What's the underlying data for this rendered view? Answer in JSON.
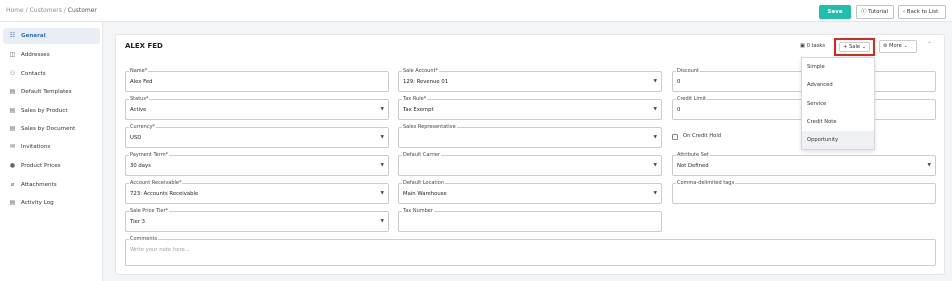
{
  "breadcrumb": {
    "home": "Home",
    "sep": "/",
    "customers": "Customers",
    "current": "Customer"
  },
  "toolbar": {
    "save": "Save",
    "tutorial": "Tutorial",
    "back": "Back to List"
  },
  "sidebar": {
    "items": [
      {
        "label": "General",
        "icon": "general-icon",
        "glyph": "☷",
        "active": true
      },
      {
        "label": "Addresses",
        "icon": "map-icon",
        "glyph": "◫",
        "active": false
      },
      {
        "label": "Contacts",
        "icon": "contacts-icon",
        "glyph": "⚇",
        "active": false
      },
      {
        "label": "Default Templates",
        "icon": "document-icon",
        "glyph": "▤",
        "active": false
      },
      {
        "label": "Sales by Product",
        "icon": "document-icon",
        "glyph": "▤",
        "active": false
      },
      {
        "label": "Sales by Document",
        "icon": "document-icon",
        "glyph": "▤",
        "active": false
      },
      {
        "label": "Invitations",
        "icon": "mail-icon",
        "glyph": "✉",
        "active": false
      },
      {
        "label": "Product Prices",
        "icon": "price-icon",
        "glyph": "●",
        "active": false
      },
      {
        "label": "Attachments",
        "icon": "paperclip-icon",
        "glyph": "⌀",
        "active": false
      },
      {
        "label": "Activity Log",
        "icon": "log-icon",
        "glyph": "▤",
        "active": false
      }
    ]
  },
  "header": {
    "title": "ALEX FED",
    "tasks": "0 tasks",
    "sale": "Sale",
    "more": "More"
  },
  "form": {
    "name": {
      "label": "Name*",
      "value": "Alex Fed"
    },
    "status": {
      "label": "Status*",
      "value": "Active"
    },
    "currency": {
      "label": "Currency*",
      "value": "USD"
    },
    "payment_term": {
      "label": "Payment Term*",
      "value": "30 days"
    },
    "account_receivable": {
      "label": "Account Receivable*",
      "value": "723: Accounts Receivable"
    },
    "sale_price_tier": {
      "label": "Sale Price Tier*",
      "value": "Tier 3"
    },
    "sale_account": {
      "label": "Sale Account*",
      "value": "129: Revenue 01"
    },
    "tax_rule": {
      "label": "Tax Rule*",
      "value": "Tax Exempt"
    },
    "sales_representative": {
      "label": "Sales Representative",
      "value": ""
    },
    "default_carrier": {
      "label": "Default Carrier",
      "value": ""
    },
    "default_location": {
      "label": "Default Location",
      "value": "Main Warehouse"
    },
    "tax_number": {
      "label": "Tax Number",
      "value": ""
    },
    "discount": {
      "label": "Discount",
      "value": "0"
    },
    "credit_limit": {
      "label": "Credit Limit",
      "value": "0"
    },
    "on_credit_hold": {
      "label": "On Credit Hold",
      "checked": false
    },
    "attribute_set": {
      "label": "Attribute Set",
      "value": "Not Defined"
    },
    "tags": {
      "label": "Comma-delimited tags",
      "value": ""
    },
    "comments": {
      "label": "Comments",
      "placeholder": "Write your note here..."
    }
  },
  "sale_menu": {
    "items": [
      "Simple",
      "Advanced",
      "Service",
      "Credit Note",
      "Opportunity"
    ]
  },
  "colors": {
    "accent": "#1fbfae",
    "highlight": "#e2261c",
    "active_nav": "#2a6bd1"
  }
}
